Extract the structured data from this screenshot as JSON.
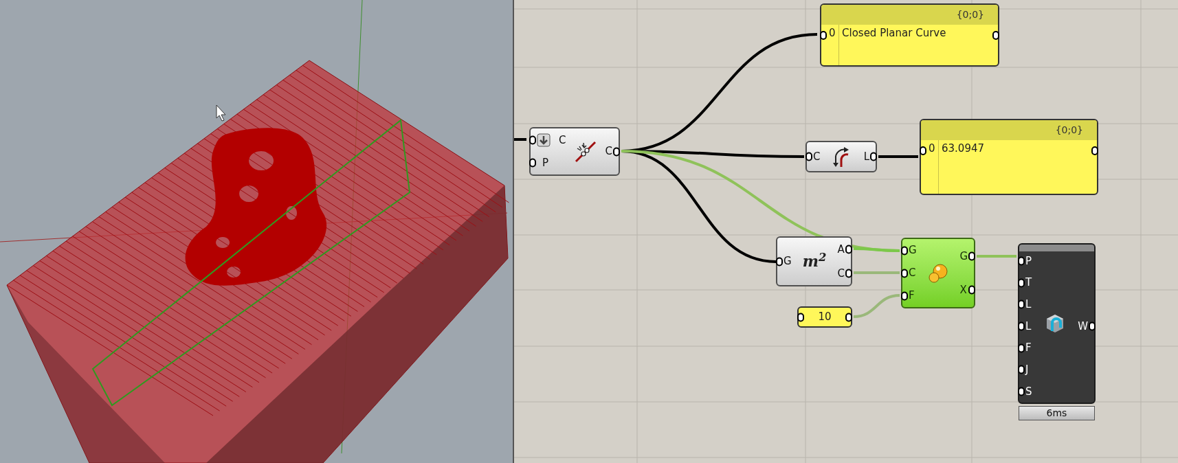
{
  "canvas": {
    "panels": [
      {
        "header": "{0;0}",
        "index": "0",
        "value": "Closed Planar Curve"
      },
      {
        "header": "{0;0}",
        "index": "0",
        "value": "63.0947"
      }
    ],
    "components": [
      {
        "kind": "curve",
        "inputs": [
          "C",
          "P"
        ],
        "outputs": [
          "C"
        ]
      },
      {
        "kind": "length",
        "inputs": [
          "C"
        ],
        "outputs": [
          "L"
        ]
      },
      {
        "kind": "area",
        "symbol": "m$^{2}$",
        "inputs": [
          "G"
        ],
        "outputs": [
          "A",
          "C"
        ]
      },
      {
        "kind": "solver",
        "inputs": [
          "G",
          "C",
          "F"
        ],
        "outputs": [
          "G",
          "X"
        ]
      },
      {
        "kind": "export",
        "inputs": [
          "P",
          "T",
          "L",
          "L",
          "F",
          "J",
          "S"
        ],
        "outputs": [
          "W"
        ],
        "timing": "6ms"
      }
    ],
    "number": {
      "value": "10"
    }
  }
}
